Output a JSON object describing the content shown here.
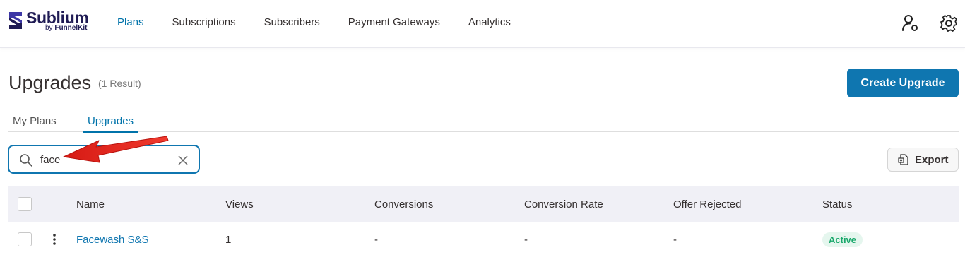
{
  "brand": {
    "name": "Sublium",
    "byline_prefix": "by",
    "byline_brand": "FunnelKit",
    "logo_icon": "sublium-logo-icon",
    "brand_color": "#1f1b54"
  },
  "nav": {
    "items": [
      {
        "label": "Plans",
        "active": true
      },
      {
        "label": "Subscriptions",
        "active": false
      },
      {
        "label": "Subscribers",
        "active": false
      },
      {
        "label": "Payment Gateways",
        "active": false
      },
      {
        "label": "Analytics",
        "active": false
      }
    ],
    "right_icons": [
      "user-settings-icon",
      "gear-icon"
    ]
  },
  "page": {
    "title": "Upgrades",
    "result_count": "(1 Result)",
    "create_button": "Create Upgrade",
    "accent_color": "#0f76b0"
  },
  "tabs": [
    {
      "label": "My Plans",
      "active": false
    },
    {
      "label": "Upgrades",
      "active": true
    }
  ],
  "search": {
    "value": "face",
    "placeholder": "",
    "icon": "search-icon",
    "clear_icon": "close-icon"
  },
  "export": {
    "label": "Export",
    "icon": "export-file-icon"
  },
  "table": {
    "columns": [
      "Name",
      "Views",
      "Conversions",
      "Conversion Rate",
      "Offer Rejected",
      "Status"
    ],
    "rows": [
      {
        "name": "Facewash S&S",
        "views": "1",
        "conversions": "-",
        "conversion_rate": "-",
        "offer_rejected": "-",
        "status": "Active"
      }
    ]
  },
  "annotation": {
    "type": "red-arrow",
    "color": "#e8201a",
    "points_to": "search-input"
  }
}
